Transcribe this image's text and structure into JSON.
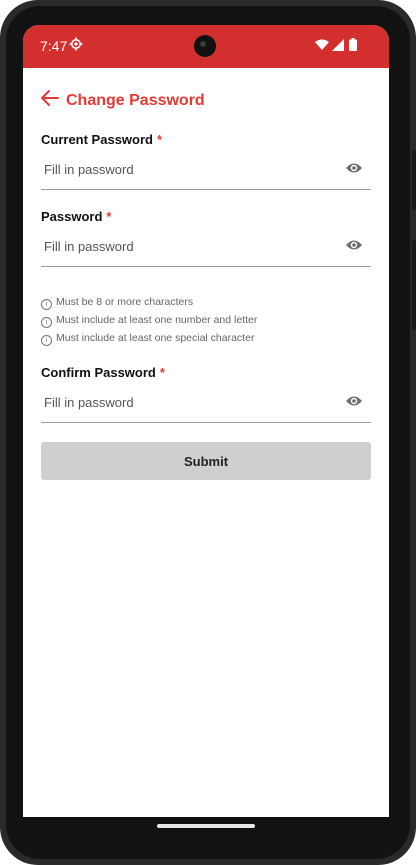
{
  "status_bar": {
    "time": "7:47",
    "bg_color": "#d32f2f",
    "icons": [
      "settings-gear-icon",
      "wifi-icon",
      "signal-icon",
      "battery-icon"
    ]
  },
  "header": {
    "back_icon": "arrow-left-icon",
    "title": "Change Password",
    "accent_color": "#e53935"
  },
  "form": {
    "current_password": {
      "label": "Current Password",
      "required_mark": "*",
      "placeholder": "Fill in password",
      "value": "",
      "toggle_icon": "eye-icon"
    },
    "password": {
      "label": "Password",
      "required_mark": "*",
      "placeholder": "Fill in password",
      "value": "",
      "toggle_icon": "eye-icon",
      "hints": [
        "Must be 8 or more characters",
        "Must include at least one number and letter",
        "Must include at least one special character"
      ]
    },
    "confirm_password": {
      "label": "Confirm Password",
      "required_mark": "*",
      "placeholder": "Fill in password",
      "value": "",
      "toggle_icon": "eye-icon"
    },
    "submit_label": "Submit"
  }
}
